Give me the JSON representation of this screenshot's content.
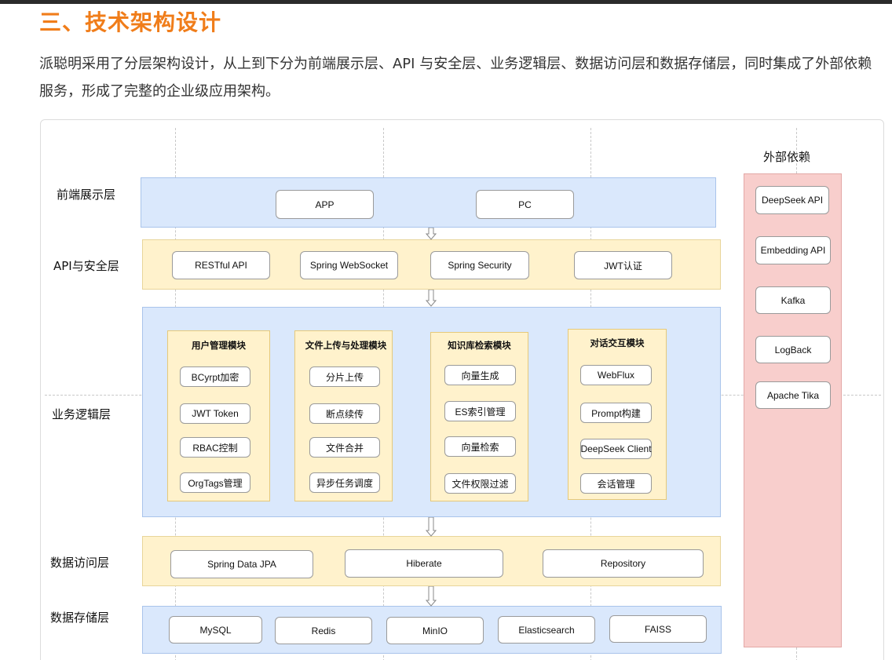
{
  "heading": "三、技术架构设计",
  "paragraph": "派聪明采用了分层架构设计，从上到下分为前端展示层、API 与安全层、业务逻辑层、数据访问层和数据存储层，同时集成了外部依赖服务，形成了完整的企业级应用架构。",
  "layers": {
    "frontend": {
      "label": "前端展示层",
      "nodes": [
        "APP",
        "PC"
      ]
    },
    "api": {
      "label": "API与安全层",
      "nodes": [
        "RESTful API",
        "Spring WebSocket",
        "Spring Security",
        "JWT认证"
      ]
    },
    "business": {
      "label": "业务逻辑层",
      "modules": [
        {
          "title": "用户管理模块",
          "items": [
            "BCyrpt加密",
            "JWT Token",
            "RBAC控制",
            "OrgTags管理"
          ]
        },
        {
          "title": "文件上传与处理模块",
          "items": [
            "分片上传",
            "断点续传",
            "文件合并",
            "异步任务调度"
          ]
        },
        {
          "title": "知识库检索模块",
          "items": [
            "向量生成",
            "ES索引管理",
            "向量检索",
            "文件权限过滤"
          ]
        },
        {
          "title": "对话交互模块",
          "items": [
            "WebFlux",
            "Prompt构建",
            "DeepSeek Client",
            "会话管理"
          ]
        }
      ]
    },
    "access": {
      "label": "数据访问层",
      "nodes": [
        "Spring Data JPA",
        "Hiberate",
        "Repository"
      ]
    },
    "storage": {
      "label": "数据存储层",
      "nodes": [
        "MySQL",
        "Redis",
        "MinIO",
        "Elasticsearch",
        "FAISS"
      ]
    }
  },
  "external": {
    "title": "外部依赖",
    "nodes": [
      "DeepSeek API",
      "Embedding API",
      "Kafka",
      "LogBack",
      "Apache Tika"
    ]
  },
  "colors": {
    "heading": "#f07d1a",
    "blue_band": "#dae8fc",
    "yellow_band": "#fff2cc",
    "external_panel": "#f8cecc"
  }
}
